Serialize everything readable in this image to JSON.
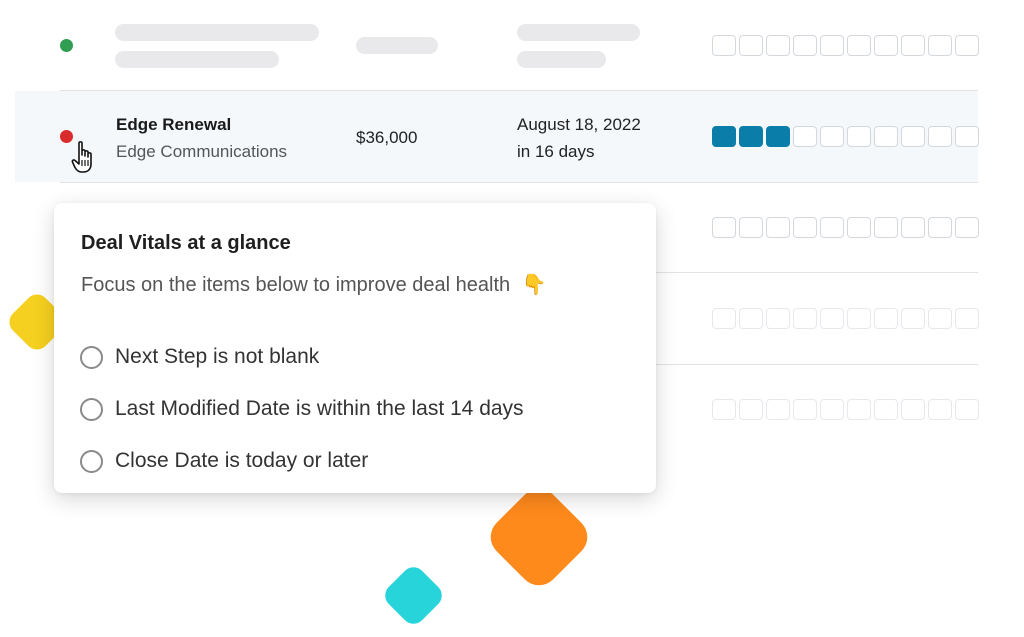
{
  "colors": {
    "status_green": "#2f9e53",
    "status_red": "#d92b2b",
    "health_filled": "#0a7ea8",
    "diamond_yellow": "#f5d020",
    "diamond_orange": "#ff8a1c",
    "diamond_teal": "#27d4d9"
  },
  "health_segments_total": 10,
  "rows": [
    {
      "status": "green",
      "placeholder": true
    },
    {
      "status": "red",
      "deal_name": "Edge Renewal",
      "account": "Edge Communications",
      "amount": "$36,000",
      "close_date": "August 18, 2022",
      "close_relative": "in 16 days",
      "health_filled": 3,
      "hovered": true
    },
    {
      "placeholder": true
    },
    {
      "placeholder": true
    },
    {
      "placeholder": true
    }
  ],
  "popover": {
    "title": "Deal Vitals at a glance",
    "subtitle": "Focus on the items below to improve deal health",
    "subtitle_emoji": "👇",
    "criteria": [
      {
        "label": "Next Step is not blank",
        "checked": false
      },
      {
        "label": "Last Modified Date is within the last 14 days",
        "checked": false
      },
      {
        "label": "Close Date is today or later",
        "checked": false
      }
    ]
  },
  "icons": {
    "cursor": "hand-pointer-icon"
  }
}
